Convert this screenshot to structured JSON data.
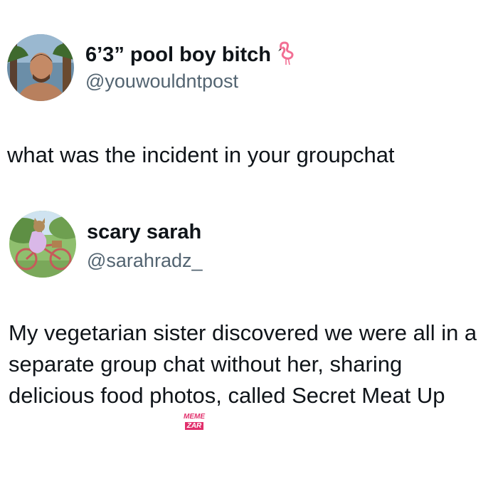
{
  "post1": {
    "display_name": "6’3” pool boy bitch",
    "name_emoji": "flamingo-icon",
    "handle": "@youwouldntpost",
    "text": "what was the incident in your groupchat"
  },
  "post2": {
    "display_name": "scary sarah",
    "handle": "@sarahradz_",
    "text": "My vegetarian sister discovered we were all in a separate group chat without her, sharing delicious food photos, called Secret Meat Up"
  },
  "watermark": {
    "line1": "MEME",
    "line2": "ZAR"
  },
  "colors": {
    "name": "#0f1419",
    "handle": "#536471",
    "watermark": "#e1306c"
  }
}
